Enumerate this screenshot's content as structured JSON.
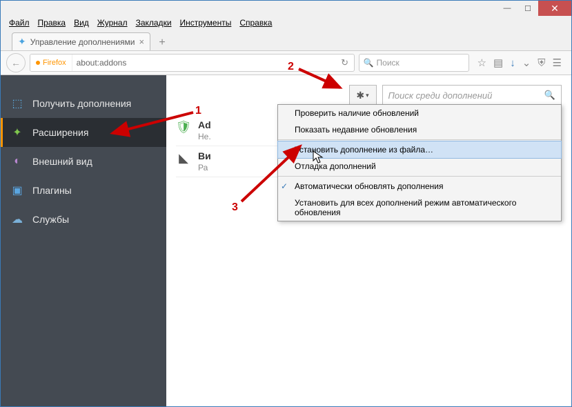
{
  "menubar": [
    "Файл",
    "Правка",
    "Вид",
    "Журнал",
    "Закладки",
    "Инструменты",
    "Справка"
  ],
  "tab": {
    "title": "Управление дополнениями"
  },
  "url": {
    "identity": "Firefox",
    "value": "about:addons"
  },
  "search": {
    "placeholder": "Поиск"
  },
  "sidebar": {
    "items": [
      {
        "label": "Получить дополнения",
        "icon": "get"
      },
      {
        "label": "Расширения",
        "icon": "ext",
        "active": true
      },
      {
        "label": "Внешний вид",
        "icon": "app"
      },
      {
        "label": "Плагины",
        "icon": "plg"
      },
      {
        "label": "Службы",
        "icon": "svc"
      }
    ]
  },
  "addon_search_placeholder": "Поиск среди дополнений",
  "addons": [
    {
      "name": "Ad",
      "sub": "Не.",
      "icon": "shield"
    },
    {
      "name": "Ви",
      "sub": "Ра",
      "icon": "bm"
    }
  ],
  "dropdown": {
    "items": [
      "Проверить наличие обновлений",
      "Показать недавние обновления",
      "Установить дополнение из файла…",
      "Отладка дополнений",
      "Автоматически обновлять дополнения",
      "Установить для всех дополнений режим автоматического обновления"
    ],
    "highlighted_index": 2,
    "checked_index": 4
  },
  "annotations": {
    "one": "1",
    "two": "2",
    "three": "3"
  }
}
